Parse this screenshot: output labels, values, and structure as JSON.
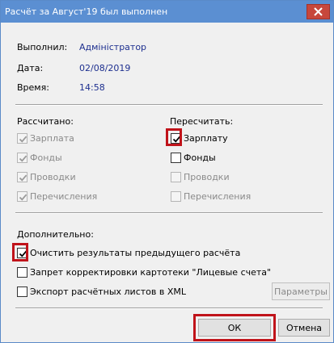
{
  "window": {
    "title": "Расчёт за Август'19 был выполнен",
    "close_icon": "close-icon"
  },
  "info": {
    "executed_by_label": "Выполнил:",
    "executed_by_value": "Адміністратор",
    "date_label": "Дата:",
    "date_value": "02/08/2019",
    "time_label": "Время:",
    "time_value": "14:58"
  },
  "calculated": {
    "label": "Рассчитано:",
    "items": [
      {
        "label": "Зарплата",
        "checked": true,
        "disabled": true
      },
      {
        "label": "Фонды",
        "checked": true,
        "disabled": true
      },
      {
        "label": "Проводки",
        "checked": true,
        "disabled": true
      },
      {
        "label": "Перечисления",
        "checked": true,
        "disabled": true
      }
    ]
  },
  "recalculate": {
    "label": "Пересчитать:",
    "items": [
      {
        "label": "Зарплату",
        "checked": true,
        "disabled": false
      },
      {
        "label": "Фонды",
        "checked": false,
        "disabled": false
      },
      {
        "label": "Проводки",
        "checked": false,
        "disabled": true
      },
      {
        "label": "Перечисления",
        "checked": false,
        "disabled": true
      }
    ]
  },
  "additional": {
    "label": "Дополнительно:",
    "options": [
      {
        "label": "Очистить результаты предыдущего расчёта",
        "checked": true
      },
      {
        "label": "Запрет корректировки картотеки \"Лицевые счета\"",
        "checked": false
      },
      {
        "label": "Экспорт расчётных листов в XML",
        "checked": false
      }
    ],
    "params_button": "Параметры"
  },
  "buttons": {
    "ok": "ОК",
    "cancel": "Отмена"
  },
  "colors": {
    "titlebar": "#5b8fd2",
    "close": "#c7473c",
    "highlight": "#c0131a",
    "info_value": "#1d2f8f"
  }
}
